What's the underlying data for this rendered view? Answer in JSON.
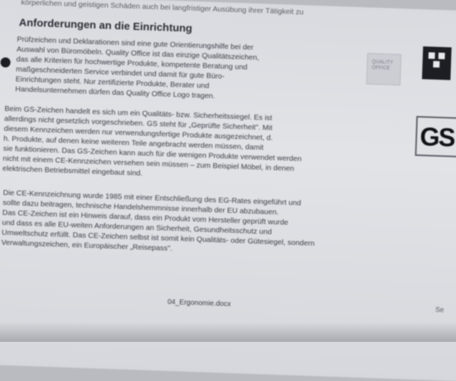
{
  "top_line": "körperlichen und geistigen Schäden auch bei langfristiger Ausübung ihrer Tätigkeit zu",
  "heading": "Anforderungen an die Einrichtung",
  "para1": [
    "Prüfzeichen und Deklarationen sind eine gute Orientierungshilfe bei der",
    "Auswahl von Büromöbeln. Quality Office ist das einzige Qualitätszeichen,",
    "das alle Kriterien für hochwertige Produkte, kompetente Beratung und",
    "maßgeschneiderten Service verbindet und damit für gute Büro-",
    "Einrichtungen steht. Nur zertifizierte Produkte, Berater und",
    "Handelsunternehmen dürfen das Quality Office Logo tragen."
  ],
  "para2": [
    "Beim GS-Zeichen handelt es sich um ein Qualitäts- bzw. Sicherheitssiegel. Es ist",
    "allerdings nicht gesetzlich vorgeschrieben. GS steht für „Geprüfte Sicherheit\". Mit",
    "diesem Kennzeichen werden nur verwendungsfertige Produkte ausgezeichnet, d.",
    "h. Produkte, auf denen keine weiteren Teile angebracht werden müssen, damit",
    "sie funktionieren. Das GS-Zeichen kann auch für die wenigen Produkte verwendet werden",
    "nicht mit einem CE-Kennzeichen versehen sein müssen – zum Beispiel Möbel, in denen",
    "elektrischen Betriebsmittel eingebaut sind."
  ],
  "para3": [
    "Die CE-Kennzeichnung wurde 1985 mit einer Entschließung des EG-Rates eingeführt und",
    "sollte dazu beitragen, technische Handelshemmnisse innerhalb der EU abzubauen.",
    "Das CE-Zeichen ist ein Hinweis darauf, dass ein Produkt vom Hersteller geprüft wurde",
    "und dass es alle EU-weiten Anforderungen an Sicherheit, Gesundheitsschutz und",
    "Umweltschutz erfüllt. Das CE-Zeichen selbst ist somit kein Qualitäts- oder Gütesiegel, sondern",
    "Verwaltungszeichen, ein Europäischer „Reisepass\"."
  ],
  "footer": "04_Ergonomie.docx",
  "corner": "Se",
  "logos": {
    "quality_office": "QUALITY OFFICE",
    "dark_logo": "Quality office",
    "gs_text": "GS"
  },
  "colors": {
    "paper": "#dedfe3",
    "text": "#3a3d45"
  }
}
